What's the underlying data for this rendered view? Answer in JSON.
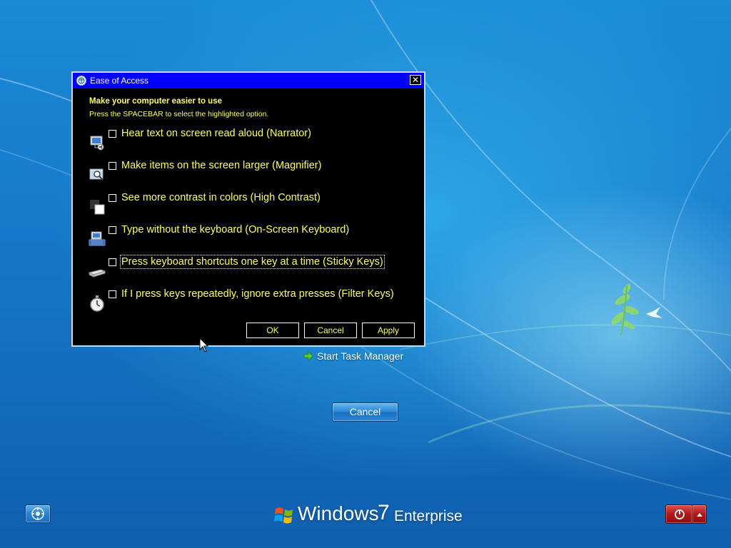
{
  "dialog": {
    "title": "Ease of Access",
    "close_label": "✕",
    "heading": "Make your computer easier to use",
    "subheading": "Press the SPACEBAR to select the highlighted option.",
    "options": [
      {
        "label": "Hear text on screen read aloud (Narrator)",
        "icon": "narrator-icon",
        "checked": false
      },
      {
        "label": "Make items on the screen larger (Magnifier)",
        "icon": "magnifier-icon",
        "checked": false
      },
      {
        "label": "See more contrast in colors (High Contrast)",
        "icon": "high-contrast-icon",
        "checked": false
      },
      {
        "label": "Type without the keyboard (On-Screen Keyboard)",
        "icon": "on-screen-keyboard-icon",
        "checked": false
      },
      {
        "label": "Press keyboard shortcuts one key at a time (Sticky Keys)",
        "icon": "sticky-keys-icon",
        "checked": false,
        "focused": true
      },
      {
        "label": "If I press keys repeatedly, ignore extra presses (Filter Keys)",
        "icon": "filter-keys-icon",
        "checked": false
      }
    ],
    "buttons": {
      "ok": "OK",
      "cancel": "Cancel",
      "apply": "Apply"
    }
  },
  "start_task_manager": "Start Task Manager",
  "cancel_button": "Cancel",
  "branding": {
    "windows": "Windows",
    "version": "7",
    "edition": "Enterprise"
  },
  "colors": {
    "dialog_bg": "#000000",
    "titlebar": "#0000ff",
    "dialog_text": "#ffff66",
    "power_button": "#b01818",
    "desktop_blue": "#1677c9"
  }
}
